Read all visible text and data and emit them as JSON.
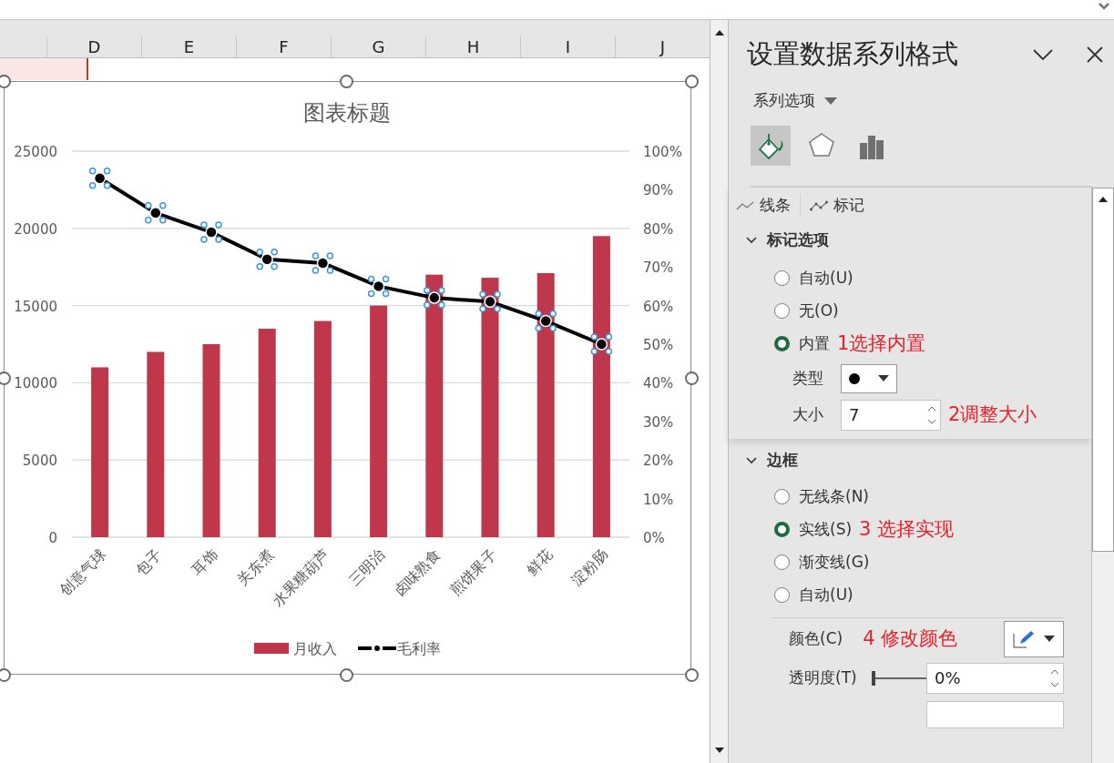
{
  "sheet": {
    "columns": [
      "D",
      "E",
      "F",
      "G",
      "H",
      "I",
      "J"
    ]
  },
  "chart": {
    "chart_data": {
      "type": "bar",
      "title": "图表标题",
      "categories": [
        "创意气球",
        "包子",
        "耳饰",
        "关东煮",
        "水果糖葫芦",
        "三明治",
        "卤味熟食",
        "煎饼果子",
        "鲜花",
        "淀粉肠"
      ],
      "series": [
        {
          "name": "月收入",
          "color": "#be374a",
          "values": [
            11000,
            12000,
            12500,
            13500,
            14000,
            15000,
            17000,
            16800,
            17100,
            19500
          ]
        },
        {
          "name": "毛利率",
          "color": "#000000",
          "type": "line",
          "axis": "y2",
          "marker": "circle",
          "values": [
            0.93,
            0.84,
            0.79,
            0.72,
            0.71,
            0.65,
            0.62,
            0.61,
            0.56,
            0.5
          ]
        }
      ],
      "grid": true,
      "legend": "bottom",
      "ylim": [
        0,
        25000
      ],
      "yticks": [
        0,
        5000,
        10000,
        15000,
        20000,
        25000
      ],
      "y2lim": [
        0,
        1
      ],
      "y2ticks": [
        {
          "value": 0,
          "label": "0%"
        },
        {
          "value": 0.1,
          "label": "10%"
        },
        {
          "value": 0.2,
          "label": "20%"
        },
        {
          "value": 0.3,
          "label": "30%"
        },
        {
          "value": 0.4,
          "label": "40%"
        },
        {
          "value": 0.5,
          "label": "50%"
        },
        {
          "value": 0.6,
          "label": "60%"
        },
        {
          "value": 0.7,
          "label": "70%"
        },
        {
          "value": 0.8,
          "label": "80%"
        },
        {
          "value": 0.9,
          "label": "90%"
        },
        {
          "value": 1,
          "label": "100%"
        }
      ]
    }
  },
  "pane": {
    "title": "设置数据系列格式",
    "menu": "系列选项",
    "icon_tabs": [
      {
        "kind": "fill",
        "selected": true
      },
      {
        "kind": "effects",
        "selected": false
      },
      {
        "kind": "series",
        "selected": false
      }
    ],
    "sub_tabs": [
      {
        "label": "线条",
        "kind": "line"
      },
      {
        "label": "标记",
        "kind": "marker"
      }
    ],
    "marker_section": {
      "title": "标记选项",
      "expanded": true,
      "options": [
        {
          "label": "自动(U)",
          "selected": false
        },
        {
          "label": "无(O)",
          "selected": false
        },
        {
          "label": "内置",
          "selected": true,
          "note": "1选择内置"
        }
      ],
      "type_label": "类型",
      "size_label": "大小",
      "size_value": "7",
      "size_note": "2调整大小"
    },
    "border_section": {
      "title": "边框",
      "expanded": true,
      "options": [
        {
          "label": "无线条(N)",
          "selected": false
        },
        {
          "label": "实线(S)",
          "selected": true,
          "note": "3 选择实现"
        },
        {
          "label": "渐变线(G)",
          "selected": false
        },
        {
          "label": "自动(U)",
          "selected": false
        }
      ],
      "color_label": "颜色(C)",
      "color_note": "4 修改颜色",
      "transparency_label": "透明度(T)",
      "transparency": {
        "level": 0,
        "reading": "0%"
      }
    }
  }
}
